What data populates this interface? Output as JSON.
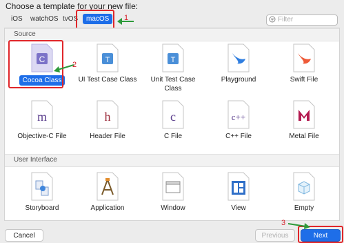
{
  "dialog": {
    "prompt": "Choose a template for your new file:"
  },
  "platform_tabs": [
    {
      "label": "iOS"
    },
    {
      "label": "watchOS"
    },
    {
      "label": "tvOS"
    },
    {
      "label": "macOS"
    }
  ],
  "search": {
    "placeholder": "Filter"
  },
  "sections": {
    "source": "Source",
    "user_interface": "User Interface"
  },
  "source_items": [
    {
      "label": "Cocoa Class",
      "icon_letter": "C"
    },
    {
      "label": "UI Test Case Class",
      "icon_letter": "T"
    },
    {
      "label": "Unit Test Case Class",
      "icon_letter": "T"
    },
    {
      "label": "Playground",
      "icon_letter": ""
    },
    {
      "label": "Swift File",
      "icon_letter": ""
    },
    {
      "label": "Objective-C File",
      "icon_letter": "m"
    },
    {
      "label": "Header File",
      "icon_letter": "h"
    },
    {
      "label": "C File",
      "icon_letter": "c"
    },
    {
      "label": "C++ File",
      "icon_letter": "c++"
    },
    {
      "label": "Metal File",
      "icon_letter": ""
    }
  ],
  "ui_items": [
    {
      "label": "Storyboard"
    },
    {
      "label": "Application"
    },
    {
      "label": "Window"
    },
    {
      "label": "View"
    },
    {
      "label": "Empty"
    }
  ],
  "annotations": {
    "one": "1",
    "two": "2",
    "three": "3"
  },
  "buttons": {
    "cancel": "Cancel",
    "previous": "Previous",
    "next": "Next"
  },
  "colors": {
    "accent": "#1e6ee8",
    "annotation": "#e0262a",
    "arrow": "#2d9a3a"
  }
}
